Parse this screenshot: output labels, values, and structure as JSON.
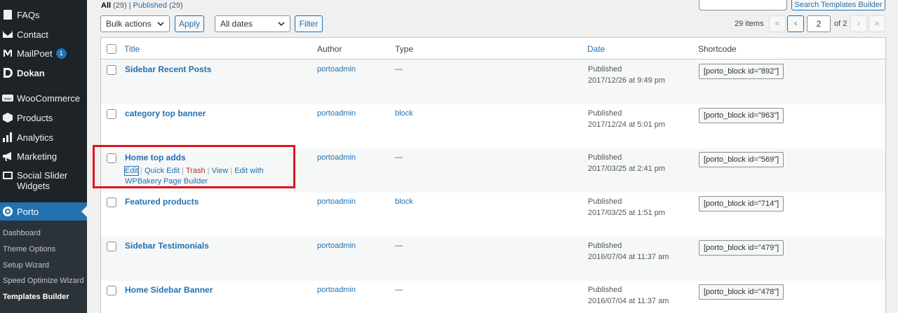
{
  "sidebar": {
    "items": [
      {
        "label": "FAQs",
        "icon": "faq-icon"
      },
      {
        "label": "Contact",
        "icon": "envelope-icon"
      },
      {
        "label": "MailPoet",
        "icon": "mailpoet-icon",
        "badge": "1"
      },
      {
        "label": "Dokan",
        "icon": "dokan-icon"
      },
      {
        "label": "WooCommerce",
        "icon": "woocommerce-icon"
      },
      {
        "label": "Products",
        "icon": "box-icon"
      },
      {
        "label": "Analytics",
        "icon": "bar-chart-icon"
      },
      {
        "label": "Marketing",
        "icon": "megaphone-icon"
      },
      {
        "label": "Social Slider Widgets",
        "icon": "slider-icon"
      },
      {
        "label": "Porto",
        "icon": "porto-icon"
      }
    ],
    "submenu": [
      {
        "label": "Dashboard"
      },
      {
        "label": "Theme Options"
      },
      {
        "label": "Setup Wizard"
      },
      {
        "label": "Speed Optimize Wizard"
      },
      {
        "label": "Templates Builder"
      }
    ]
  },
  "filters": {
    "all_label": "All",
    "all_count": "(29)",
    "published_label": "Published",
    "published_count": "(29)",
    "separator": "|",
    "bulk_actions": "Bulk actions",
    "apply": "Apply",
    "dates": "All dates",
    "filter": "Filter",
    "search_button": "Search Templates Builder"
  },
  "pagination": {
    "items": "29 items",
    "first": "«",
    "prev": "‹",
    "current_page": "2",
    "of_pages": "of 2",
    "next": "›",
    "last": "»"
  },
  "table": {
    "columns": {
      "title": "Title",
      "author": "Author",
      "type": "Type",
      "date": "Date",
      "shortcode": "Shortcode"
    },
    "rows": [
      {
        "title": "Sidebar Recent Posts",
        "author": "portoadmin",
        "type": "—",
        "status": "Published",
        "datetime": "2017/12/26 at 9:49 pm",
        "shortcode": "[porto_block id=\"892\"]"
      },
      {
        "title": "category top banner",
        "author": "portoadmin",
        "type": "block",
        "status": "Published",
        "datetime": "2017/12/24 at 5:01 pm",
        "shortcode": "[porto_block id=\"963\"]"
      },
      {
        "title": "Home top adds",
        "author": "portoadmin",
        "type": "—",
        "status": "Published",
        "datetime": "2017/03/25 at 2:41 pm",
        "shortcode": "[porto_block id=\"569\"]"
      },
      {
        "title": "Featured products",
        "author": "portoadmin",
        "type": "block",
        "status": "Published",
        "datetime": "2017/03/25 at 1:51 pm",
        "shortcode": "[porto_block id=\"714\"]"
      },
      {
        "title": "Sidebar Testimonials",
        "author": "portoadmin",
        "type": "—",
        "status": "Published",
        "datetime": "2016/07/04 at 11:37 am",
        "shortcode": "[porto_block id=\"479\"]"
      },
      {
        "title": "Home Sidebar Banner",
        "author": "portoadmin",
        "type": "—",
        "status": "Published",
        "datetime": "2016/07/04 at 11:37 am",
        "shortcode": "[porto_block id=\"478\"]"
      }
    ],
    "row_actions": {
      "edit": "Edit",
      "quick_edit": "Quick Edit",
      "trash": "Trash",
      "view": "View",
      "edit_wpbakery": "Edit with WPBakery Page Builder",
      "sep": "|"
    }
  },
  "colors": {
    "accent": "#2271b1",
    "sidebar_bg": "#1d2327",
    "highlight": "#e0141e",
    "trash": "#b32d2e"
  }
}
